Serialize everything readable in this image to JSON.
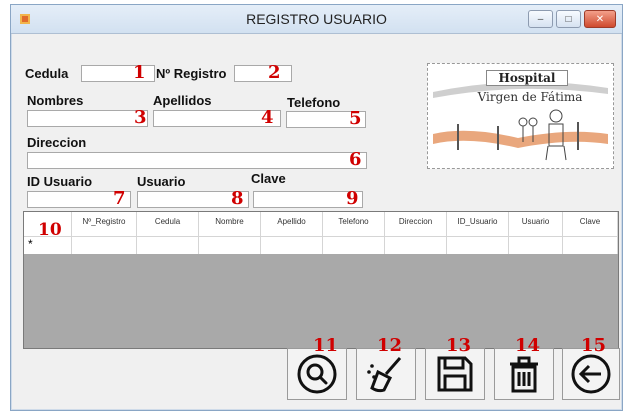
{
  "window": {
    "title": "REGISTRO USUARIO",
    "controls": [
      "minimize",
      "maximize",
      "close"
    ]
  },
  "form": {
    "cedula_label": "Cedula",
    "registro_label": "Nº Registro",
    "nombres_label": "Nombres",
    "apellidos_label": "Apellidos",
    "telefono_label": "Telefono",
    "direccion_label": "Direccion",
    "idusuario_label": "ID Usuario",
    "usuario_label": "Usuario",
    "clave_label": "Clave"
  },
  "annotations": [
    "1",
    "2",
    "3",
    "4",
    "5",
    "6",
    "7",
    "8",
    "9",
    "10",
    "11",
    "12",
    "13",
    "14",
    "15"
  ],
  "logo": {
    "line1": "Hospital",
    "line2": "Virgen de Fátima"
  },
  "grid": {
    "columns": [
      "Nº_Registro",
      "Cedula",
      "Nombre",
      "Apellido",
      "Telefono",
      "Direccion",
      "ID_Usuario",
      "Usuario",
      "Clave"
    ],
    "new_row_marker": "*"
  },
  "toolbar": {
    "icons": [
      "search-icon",
      "broom-icon",
      "save-icon",
      "trash-icon",
      "back-arrow-icon"
    ]
  },
  "colors": {
    "annotation": "#d00000",
    "grid_bg": "#a9a9a9",
    "titlebar": "#d2e1f1"
  }
}
